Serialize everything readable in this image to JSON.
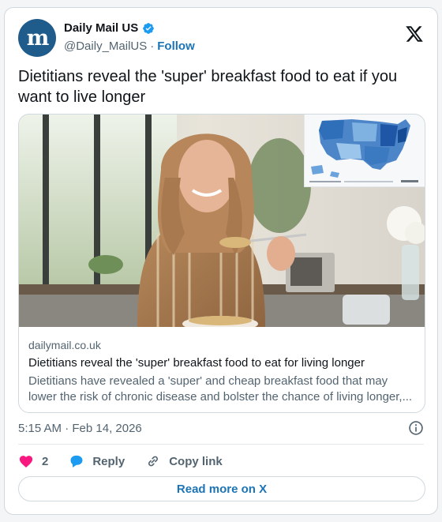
{
  "author": {
    "display_name": "Daily Mail US",
    "handle": "@Daily_MailUS",
    "separator": "·",
    "follow_label": "Follow",
    "avatar_letter": "m",
    "avatar_color": "#1f5c8c",
    "verified": true
  },
  "tweet": {
    "text": "Dietitians reveal the 'super' breakfast food to eat if you want to live longer"
  },
  "link_card": {
    "image_alt": "Woman eating a bowl of breakfast cereal with a US map inset",
    "domain": "dailymail.co.uk",
    "title": "Dietitians reveal the 'super' breakfast food to eat for living longer",
    "description": "Dietitians have revealed a 'super' and cheap breakfast food that may lower the risk of chronic disease and bolster the chance of living longer,..."
  },
  "meta": {
    "timestamp": "5:15 AM · Feb 14, 2026"
  },
  "actions": {
    "like_count": "2",
    "reply_label": "Reply",
    "copy_link_label": "Copy link",
    "read_more_label": "Read more on X"
  },
  "colors": {
    "link_blue": "#1d74b5",
    "heart": "#f91880",
    "reply_bubble": "#1d9bf0",
    "muted_text": "#536471",
    "border": "#cfd9de"
  },
  "icons": [
    "verified-badge-icon",
    "x-logo-icon",
    "info-icon",
    "heart-icon",
    "reply-bubble-icon",
    "link-icon"
  ]
}
